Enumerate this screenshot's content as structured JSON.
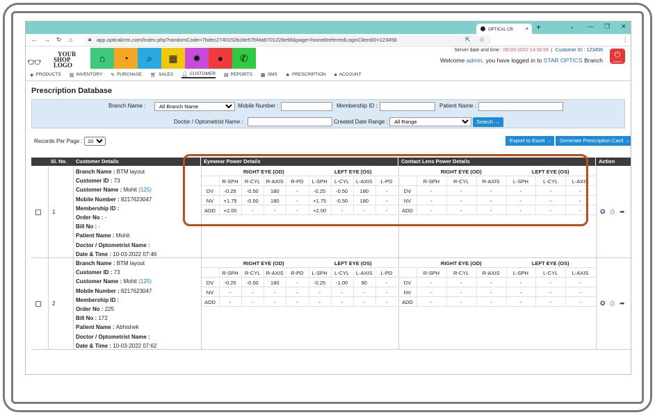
{
  "browser": {
    "tab_title": "OPTICAL CR",
    "url": "app.opticalcrm.com/index.php?randomCode=7bdec2740152bc8e57bf4a9701228e98&page=home8referredLoginClientID=123456"
  },
  "header": {
    "logo_line1": "YOUR",
    "logo_line2": "SHOP LOGO",
    "server_label": "Server date and time : ",
    "server_value": "05-03-2022 14:36:59",
    "customer_id_label": "Customer ID : 123456",
    "welcome_prefix": "Welcome ",
    "welcome_user": "admin",
    "welcome_mid": ", you have logged in to ",
    "welcome_branch": "STAR OPTICS",
    "welcome_suffix": " Branch",
    "logout_label": "LOGOUT"
  },
  "modules": [
    {
      "icon": "home-icon",
      "glyph": "⌂",
      "color": "#3fc97a"
    },
    {
      "icon": "dashboard-icon",
      "glyph": "◔",
      "color": "#f5a623"
    },
    {
      "icon": "search-icon",
      "glyph": "⌕",
      "color": "#27a9e1"
    },
    {
      "icon": "grid-icon",
      "glyph": "▦",
      "color": "#f0c808"
    },
    {
      "icon": "gear-icon",
      "glyph": "✹",
      "color": "#c84bdb"
    },
    {
      "icon": "user-icon",
      "glyph": "●",
      "color": "#ef3b3b"
    },
    {
      "icon": "whatsapp-icon",
      "glyph": "✆",
      "color": "#2ecc40"
    }
  ],
  "menu": [
    "PRODUCTS",
    "INVENTORY",
    "PURCHASE",
    "SALES",
    "CUSTOMER",
    "REPORTS",
    "SMS",
    "PRESCRIPTION",
    "ACCOUNT"
  ],
  "page_title": "Prescription Database",
  "search": {
    "branch_label": "Branch Name :",
    "branch_value": "All Branch Name",
    "mobile_label": "Mobile Number :",
    "membership_label": "Membership ID :",
    "patient_label": "Patient Name :",
    "doctor_label": "Doctor / Optometrist Name :",
    "created_label": "Created Date Range :",
    "created_value": "All Range",
    "search_button": "Search →"
  },
  "table": {
    "records_label": "Records Per Page :",
    "records_value": "10",
    "export_button": "Export to Excel →",
    "generate_button": "Generate Prescription Card →",
    "headers": {
      "sl": "Sl. No.",
      "customer": "Customer Details",
      "eyewear": "Eyewear Power Details",
      "contact": "Contact Lens Power Details",
      "action": "Action"
    },
    "right_eye": "RIGHT EYE (OD)",
    "left_eye": "LEFT EYE (OS)",
    "cols_eyewear": [
      "R-SPH",
      "R-CYL",
      "R-AXIS",
      "R-PD",
      "L-SPH",
      "L-CYL",
      "L-AXIS",
      "L-PD"
    ],
    "cols_contact": [
      "R-SPH",
      "R-CYL",
      "R-AXIS",
      "L-SPH",
      "L-CYL",
      "L-AXIS"
    ],
    "row_labels": [
      "DV",
      "NV",
      "ADD"
    ],
    "rows": [
      {
        "sl": "1",
        "details": [
          [
            "Branch Name : ",
            "BTM layout",
            ""
          ],
          [
            "Customer ID : ",
            "73",
            ""
          ],
          [
            "Customer Name : ",
            "Mohit ",
            "(125)"
          ],
          [
            "Mobile Number : ",
            "8217623047",
            ""
          ],
          [
            "Membership ID :",
            "",
            ""
          ],
          [
            "Order No : ",
            "-",
            ""
          ],
          [
            "Bill No : ",
            "-",
            ""
          ],
          [
            "Patient Name : ",
            "Mohit",
            ""
          ],
          [
            "Doctor / Optometrist Name :",
            "",
            ""
          ],
          [
            "Date & Time : ",
            "10-03-2022 07:46",
            ""
          ]
        ],
        "eyewear": [
          [
            "-0.25",
            "-0.50",
            "180",
            "-",
            "-0.25",
            "-0.50",
            "180",
            "-"
          ],
          [
            "+1.75",
            "-0.50",
            "180",
            "-",
            "+1.75",
            "-0.50",
            "180",
            "-"
          ],
          [
            "+2.00",
            "-",
            "-",
            "-",
            "+2.00",
            "-",
            "-",
            "-"
          ]
        ],
        "contact": [
          [
            "-",
            "-",
            "-",
            "-",
            "-",
            "-"
          ],
          [
            "-",
            "-",
            "-",
            "-",
            "-",
            "-"
          ],
          [
            "-",
            "-",
            "-",
            "-",
            "-",
            "-"
          ]
        ]
      },
      {
        "sl": "2",
        "details": [
          [
            "Branch Name : ",
            "BTM layout",
            ""
          ],
          [
            "Customer ID : ",
            "73",
            ""
          ],
          [
            "Customer Name : ",
            "Mohit ",
            "(125)"
          ],
          [
            "Mobile Number : ",
            "8217623047",
            ""
          ],
          [
            "Membership ID :",
            "",
            ""
          ],
          [
            "Order No : ",
            "225",
            ""
          ],
          [
            "Bill No : ",
            "172",
            ""
          ],
          [
            "Patient Name : ",
            "Abhishek",
            ""
          ],
          [
            "Doctor / Optometrist Name :",
            "",
            ""
          ],
          [
            "Date & Time : ",
            "10-03-2022 07:62",
            ""
          ]
        ],
        "eyewear": [
          [
            "-0.25",
            "-0.50",
            "180",
            "-",
            "-0.25",
            "-1.00",
            "90",
            "-"
          ],
          [
            "-",
            "-",
            "-",
            "-",
            "-",
            "-",
            "-",
            "-"
          ],
          [
            "-",
            "-",
            "-",
            "-",
            "-",
            "-",
            "-",
            "-"
          ]
        ],
        "contact": [
          [
            "-",
            "-",
            "-",
            "-",
            "-",
            "-"
          ],
          [
            "-",
            "-",
            "-",
            "-",
            "-",
            "-"
          ],
          [
            "-",
            "-",
            "-",
            "-",
            "-",
            "-"
          ]
        ]
      }
    ]
  }
}
